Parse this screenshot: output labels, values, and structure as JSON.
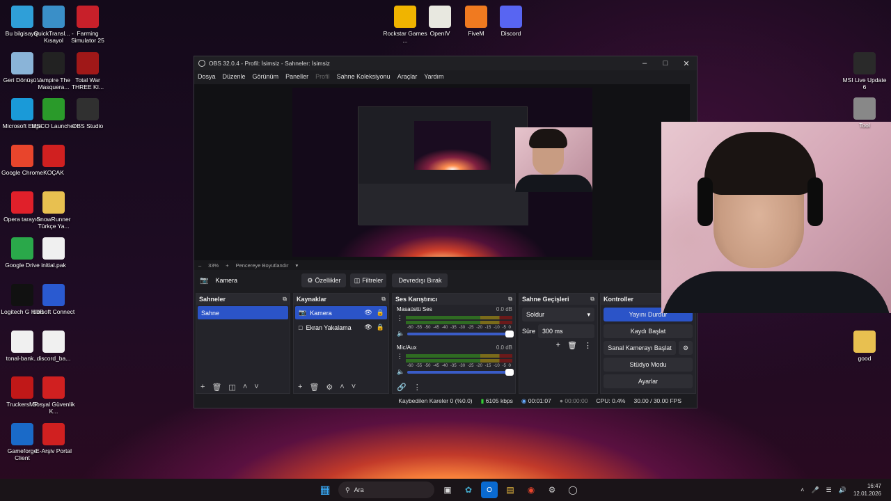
{
  "desktop_left": [
    {
      "label": "Bu bilgisayar",
      "icon": "pc-icon",
      "color": "#2f9fd8"
    },
    {
      "label": "QuickTransl... - Kısayol",
      "icon": "gear-icon",
      "color": "#3a8fc8"
    },
    {
      "label": "Farming Simulator 25",
      "icon": "fs-icon",
      "color": "#c8202a"
    },
    {
      "label": "Geri Dönüşü...",
      "icon": "recycle-bin-icon",
      "color": "#8ab4d8"
    },
    {
      "label": "Vampire The Masquera...",
      "icon": "vampire-icon",
      "color": "#222"
    },
    {
      "label": "Total War THREE KI...",
      "icon": "totalwar-icon",
      "color": "#a01818"
    },
    {
      "label": "Microsoft Edge",
      "icon": "edge-icon",
      "color": "#1a9ad8"
    },
    {
      "label": "MSCO Launcher",
      "icon": "msc-icon",
      "color": "#2a9a2a"
    },
    {
      "label": "OBS Studio",
      "icon": "obs-icon",
      "color": "#303030"
    },
    {
      "label": "Google Chrome",
      "icon": "chrome-icon",
      "color": "#e8452c"
    },
    {
      "label": "KOÇAK",
      "icon": "pdf-icon",
      "color": "#d02020"
    },
    {
      "label": "Opera tarayıcı",
      "icon": "opera-icon",
      "color": "#e0202a"
    },
    {
      "label": "SnowRunner Türkçe Ya...",
      "icon": "folder-icon",
      "color": "#e8c050"
    },
    {
      "label": "Google Drive",
      "icon": "drive-icon",
      "color": "#2aa84a"
    },
    {
      "label": "initial.pak",
      "icon": "file-icon",
      "color": "#f0f0f0"
    },
    {
      "label": "Logitech G HUB",
      "icon": "logitech-icon",
      "color": "#111"
    },
    {
      "label": "Ubisoft Connect",
      "icon": "ubisoft-icon",
      "color": "#2a5ad0"
    },
    {
      "label": "tonal-bank...",
      "icon": "file-icon",
      "color": "#f0f0f0"
    },
    {
      "label": "discord_ba...",
      "icon": "file-icon",
      "color": "#f0f0f0"
    },
    {
      "label": "TruckersMP",
      "icon": "truckersmp-icon",
      "color": "#c01818"
    },
    {
      "label": "Sosyal Güvenlik K...",
      "icon": "pdf-icon",
      "color": "#d02020"
    },
    {
      "label": "Gameforge Client",
      "icon": "gameforge-icon",
      "color": "#1a6ac8"
    },
    {
      "label": "E-Arşiv Portal",
      "icon": "pdf-icon",
      "color": "#d02020"
    }
  ],
  "desktop_top": [
    {
      "label": "Rockstar Games ...",
      "icon": "rockstar-icon",
      "color": "#f0b400"
    },
    {
      "label": "OpenIV",
      "icon": "openiv-icon",
      "color": "#e8e8e0"
    },
    {
      "label": "FiveM",
      "icon": "fivem-icon",
      "color": "#f07a20"
    },
    {
      "label": "Discord",
      "icon": "discord-icon",
      "color": "#5865f2"
    }
  ],
  "desktop_right": [
    {
      "label": "MSI Live Update 6",
      "icon": "msi-icon",
      "color": "#2a2a2a"
    },
    {
      "label": "Tool",
      "icon": "tool-icon",
      "color": "#888"
    },
    {
      "label": "good",
      "icon": "folder-icon",
      "color": "#e8c050"
    }
  ],
  "obs": {
    "title": "OBS 32.0.4 - Profil: İsimsiz - Sahneler: İsimsiz",
    "menu": [
      "Dosya",
      "Düzenle",
      "Görünüm",
      "Paneller",
      "Profil",
      "Sahne Koleksiyonu",
      "Araçlar",
      "Yardım"
    ],
    "zoom": "33%",
    "zoom_mode": "Pencereye Boyutlandır",
    "selected_source": "Kamera",
    "btn_properties": "Özellikler",
    "btn_filters": "Filtreler",
    "btn_deactivate": "Devredışı Bırak",
    "scenes_title": "Sahneler",
    "scene": "Sahne",
    "sources_title": "Kaynaklar",
    "sources": [
      "Kamera",
      "Ekran Yakalama"
    ],
    "mixer_title": "Ses Karıştırıcı",
    "mixer": [
      {
        "name": "Masaüstü Ses",
        "db": "0.0 dB"
      },
      {
        "name": "Mic/Aux",
        "db": "0.0 dB"
      }
    ],
    "ticks": [
      "-60",
      "-55",
      "-50",
      "-45",
      "-40",
      "-35",
      "-30",
      "-25",
      "-20",
      "-15",
      "-10",
      "-5",
      "0"
    ],
    "transitions_title": "Sahne Geçişleri",
    "transition": "Soldur",
    "duration_label": "Süre",
    "duration": "300 ms",
    "controls_title": "Kontroller",
    "controls": [
      "Yayını Durdur",
      "Kaydı Başlat",
      "Sanal Kamerayı Başlat",
      "Stüdyo Modu",
      "Ayarlar"
    ],
    "status": {
      "dropped": "Kaybedilen Kareler 0 (%0.0)",
      "bitrate": "6105 kbps",
      "stream_time": "00:01:07",
      "rec_time": "00:00:00",
      "cpu": "CPU: 0.4%",
      "fps": "30.00 / 30.00 FPS"
    }
  },
  "taskbar": {
    "search": "Ara",
    "time": "16:47",
    "date": "12.01.2026"
  }
}
